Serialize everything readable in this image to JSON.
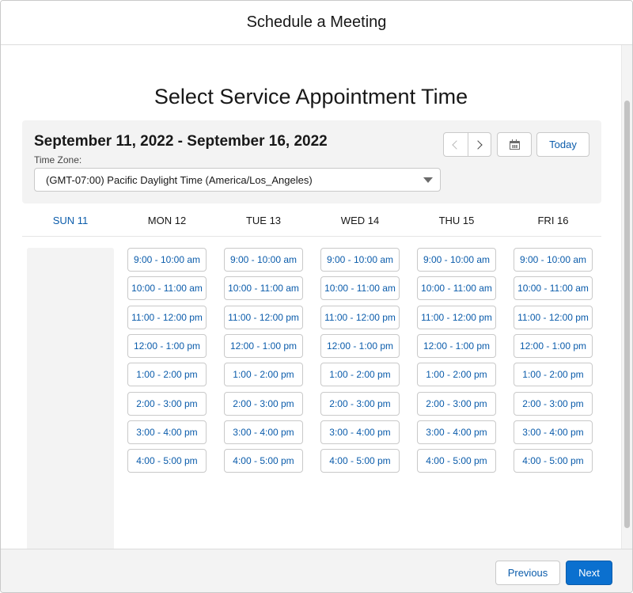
{
  "modal": {
    "title": "Schedule a Meeting"
  },
  "page": {
    "title": "Select Service Appointment Time"
  },
  "toolbar": {
    "date_range": "September 11, 2022 - September 16, 2022",
    "timezone_label": "Time Zone:",
    "timezone_value": "(GMT-07:00) Pacific Daylight Time (America/Los_Angeles)",
    "prev_icon": "chevron-left-icon",
    "next_icon": "chevron-right-icon",
    "calendar_icon": "calendar-icon",
    "today_label": "Today"
  },
  "days": [
    {
      "label": "SUN 11",
      "active": true,
      "slots": []
    },
    {
      "label": "MON 12",
      "active": false,
      "slots": [
        "9:00 - 10:00 am",
        "10:00 - 11:00 am",
        "11:00 - 12:00 pm",
        "12:00 - 1:00 pm",
        "1:00 - 2:00 pm",
        "2:00 - 3:00 pm",
        "3:00 - 4:00 pm",
        "4:00 - 5:00 pm"
      ]
    },
    {
      "label": "TUE 13",
      "active": false,
      "slots": [
        "9:00 - 10:00 am",
        "10:00 - 11:00 am",
        "11:00 - 12:00 pm",
        "12:00 - 1:00 pm",
        "1:00 - 2:00 pm",
        "2:00 - 3:00 pm",
        "3:00 - 4:00 pm",
        "4:00 - 5:00 pm"
      ]
    },
    {
      "label": "WED 14",
      "active": false,
      "slots": [
        "9:00 - 10:00 am",
        "10:00 - 11:00 am",
        "11:00 - 12:00 pm",
        "12:00 - 1:00 pm",
        "1:00 - 2:00 pm",
        "2:00 - 3:00 pm",
        "3:00 - 4:00 pm",
        "4:00 - 5:00 pm"
      ]
    },
    {
      "label": "THU 15",
      "active": false,
      "slots": [
        "9:00 - 10:00 am",
        "10:00 - 11:00 am",
        "11:00 - 12:00 pm",
        "12:00 - 1:00 pm",
        "1:00 - 2:00 pm",
        "2:00 - 3:00 pm",
        "3:00 - 4:00 pm",
        "4:00 - 5:00 pm"
      ]
    },
    {
      "label": "FRI 16",
      "active": false,
      "slots": [
        "9:00 - 10:00 am",
        "10:00 - 11:00 am",
        "11:00 - 12:00 pm",
        "12:00 - 1:00 pm",
        "1:00 - 2:00 pm",
        "2:00 - 3:00 pm",
        "3:00 - 4:00 pm",
        "4:00 - 5:00 pm"
      ]
    }
  ],
  "footer": {
    "previous_label": "Previous",
    "next_label": "Next"
  },
  "colors": {
    "accent": "#0b5cab",
    "primary_button": "#0b70cf",
    "panel_bg": "#f3f3f3",
    "border": "#c9c9c9"
  }
}
